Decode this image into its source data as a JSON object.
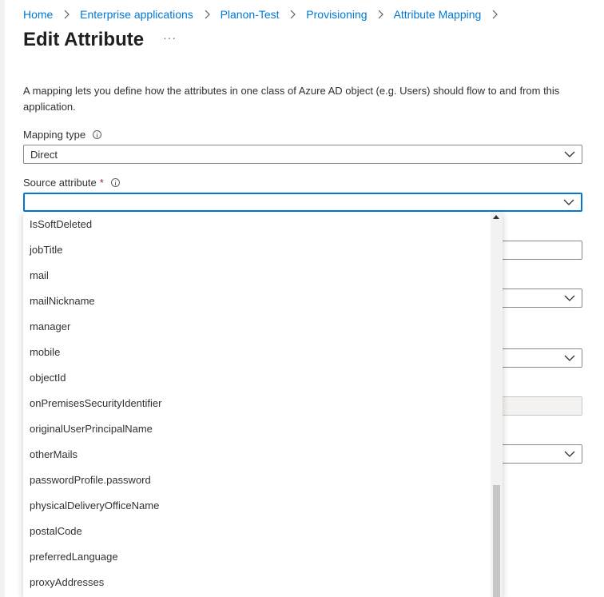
{
  "breadcrumb": {
    "items": [
      "Home",
      "Enterprise applications",
      "Planon-Test",
      "Provisioning",
      "Attribute Mapping"
    ]
  },
  "page": {
    "title": "Edit Attribute",
    "more_label": "···",
    "description": "A mapping lets you define how the attributes in one class of Azure AD object (e.g. Users) should flow to and from this application."
  },
  "form": {
    "mapping_type": {
      "label": "Mapping type",
      "value": "Direct"
    },
    "source_attribute": {
      "label": "Source attribute",
      "required_mark": "*",
      "value": ""
    }
  },
  "dropdown": {
    "options": [
      "IsSoftDeleted",
      "jobTitle",
      "mail",
      "mailNickname",
      "manager",
      "mobile",
      "objectId",
      "onPremisesSecurityIdentifier",
      "originalUserPrincipalName",
      "otherMails",
      "passwordProfile.password",
      "physicalDeliveryOfficeName",
      "postalCode",
      "preferredLanguage",
      "proxyAddresses"
    ]
  },
  "colors": {
    "accent": "#0078d4",
    "required": "#a4262c",
    "text": "#323130"
  }
}
